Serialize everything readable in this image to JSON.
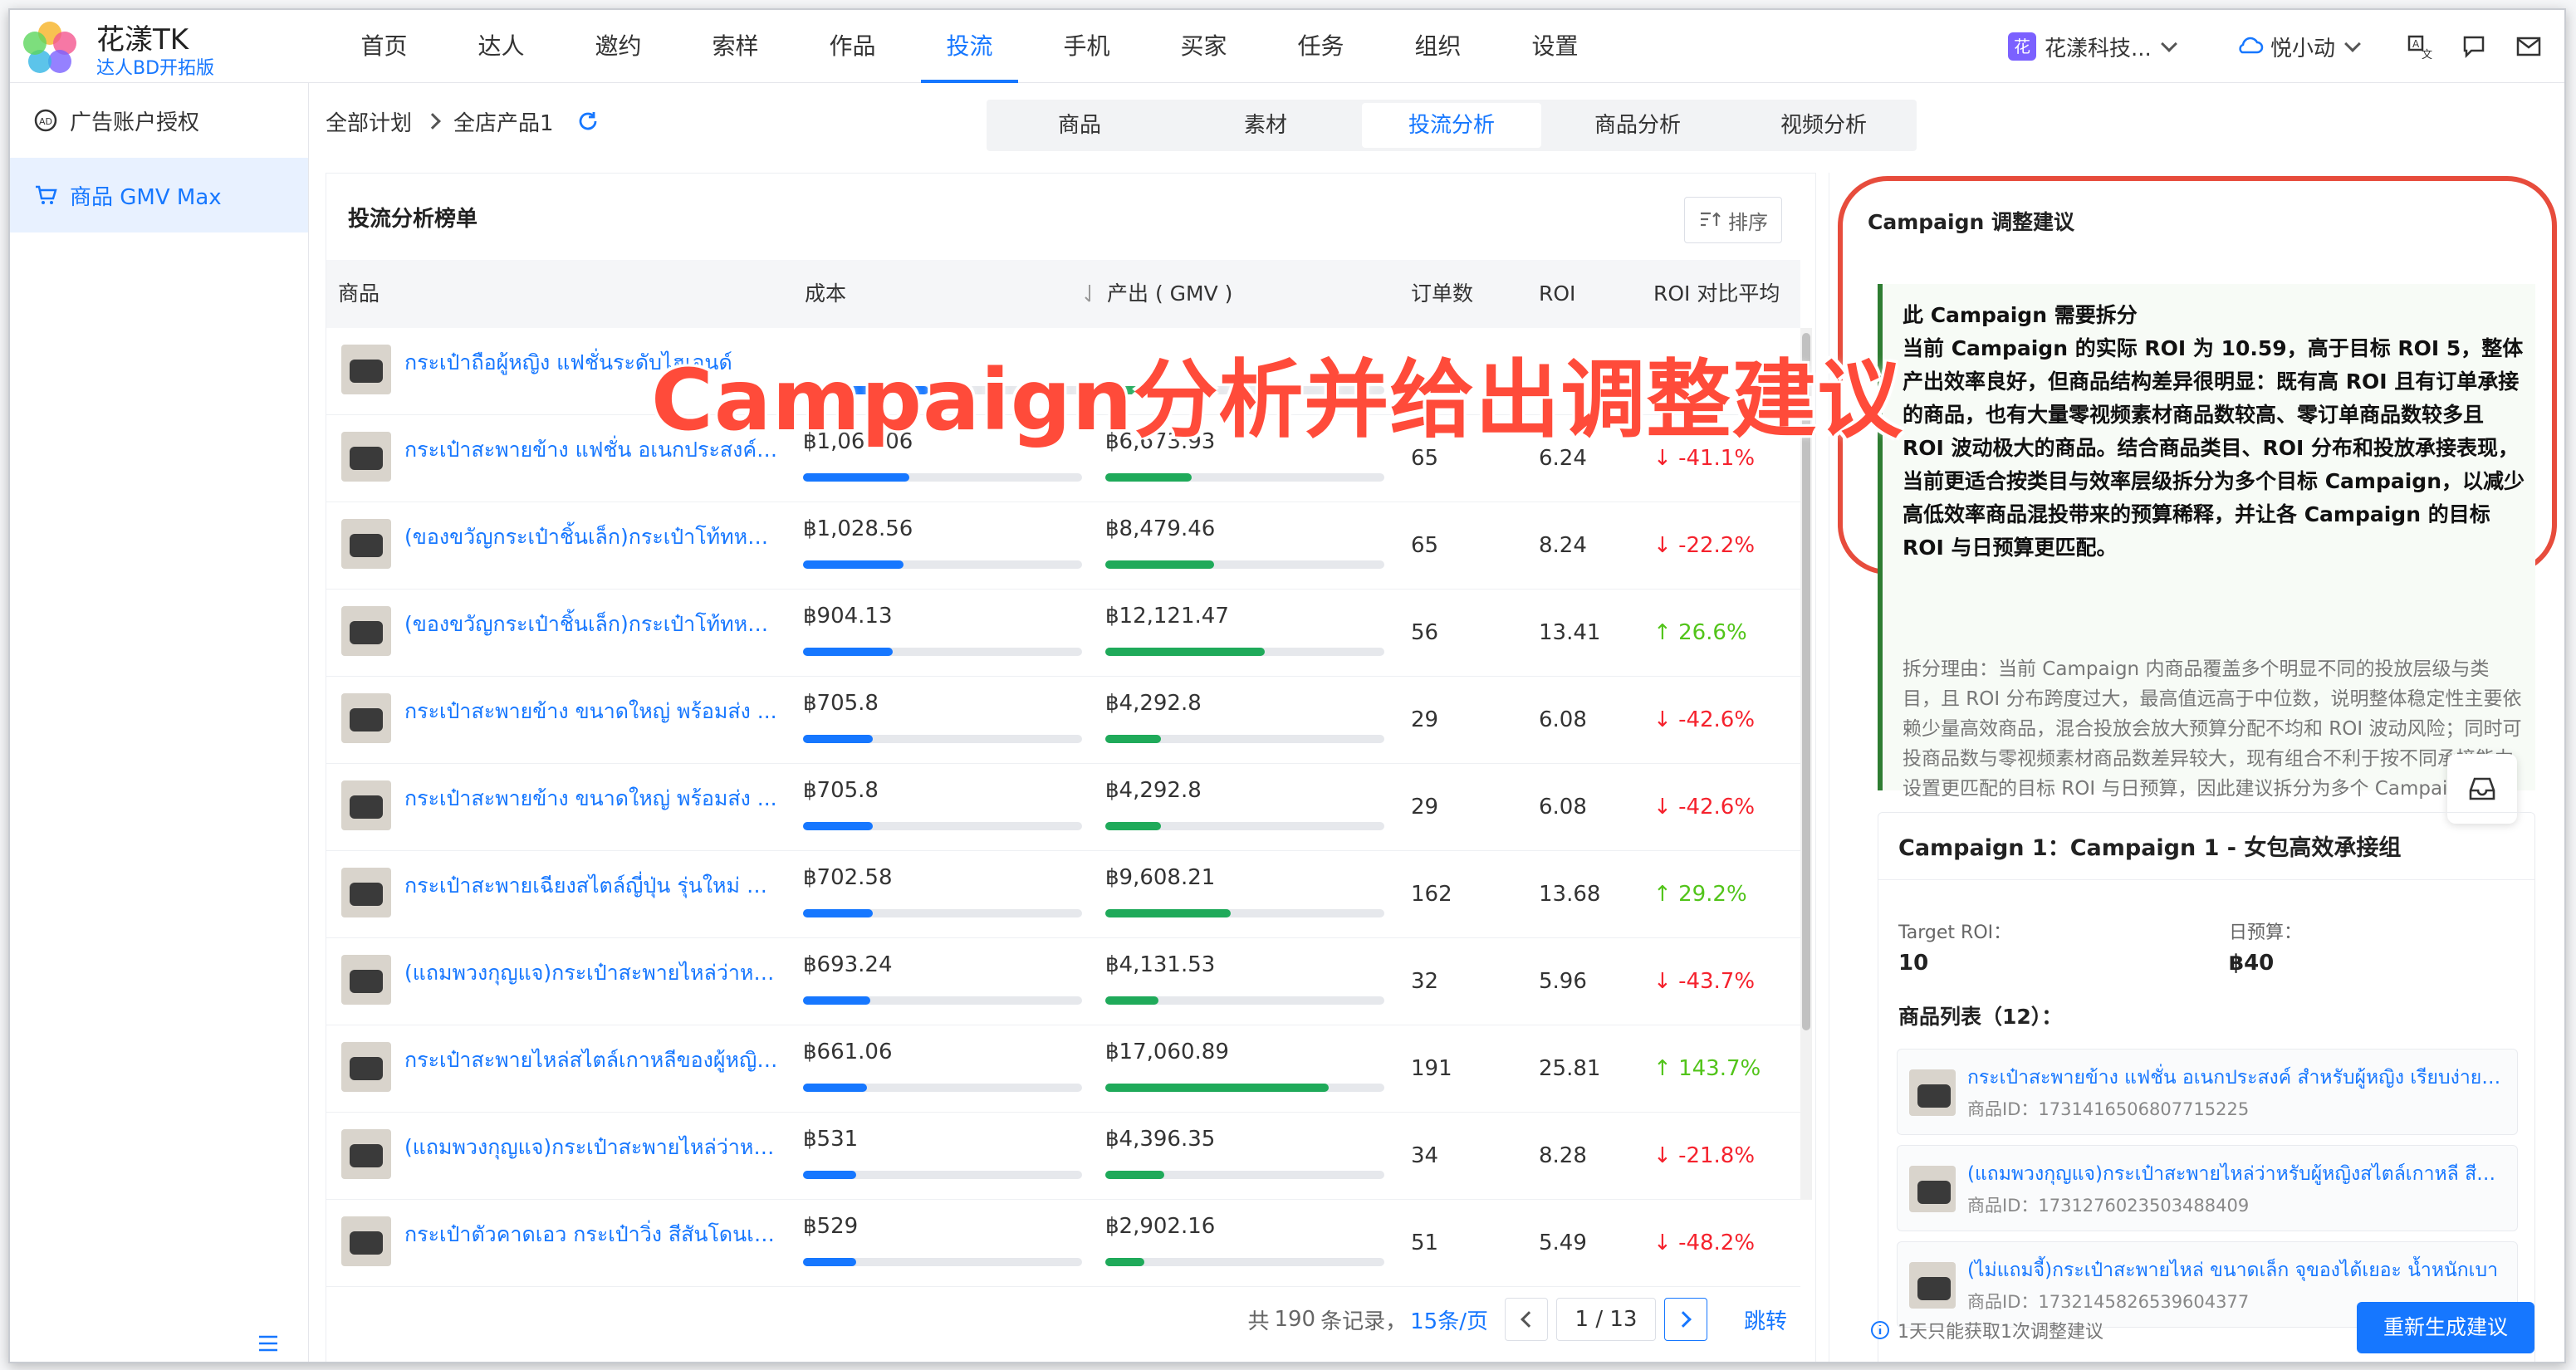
{
  "app": {
    "title": "花漾TK",
    "subtitle": "达人BD开拓版"
  },
  "nav": {
    "items": [
      "首页",
      "达人",
      "邀约",
      "索样",
      "作品",
      "投流",
      "手机",
      "买家",
      "任务",
      "组织",
      "设置"
    ],
    "active": "投流"
  },
  "topright": {
    "org_badge": "花",
    "org_name": "花漾科技...",
    "user_name": "悦小动"
  },
  "sidebar": {
    "items": [
      "广告账户授权",
      "商品 GMV Max"
    ],
    "active": "商品 GMV Max"
  },
  "breadcrumb": {
    "root": "全部计划",
    "current": "全店产品1"
  },
  "tabs": {
    "items": [
      "商品",
      "素材",
      "投流分析",
      "商品分析",
      "视频分析"
    ],
    "active": "投流分析"
  },
  "ranking": {
    "title": "投流分析榜单",
    "sort_label": "排序",
    "headers": {
      "product": "商品",
      "cost": "成本",
      "gmv": "产出 ( GMV )",
      "orders": "订单数",
      "roi": "ROI",
      "roi_vs_avg": "ROI 对比平均"
    },
    "rows": [
      {
        "name": "กระเป๋าถือผู้หญิง แฟชั่นระดับไฮเอนด์",
        "cost": "",
        "cost_pct": 0.45,
        "gmv": "",
        "gmv_pct": 0.3,
        "orders": "",
        "roi": "",
        "cmp": "",
        "dir": ""
      },
      {
        "name": "กระเป๋าสะพายข้าง แฟชั่น อเนกประสงค์ ...",
        "cost": "฿1,069.06",
        "cost_pct": 0.38,
        "gmv": "฿6,673.93",
        "gmv_pct": 0.31,
        "orders": "65",
        "roi": "6.24",
        "cmp": "-41.1%",
        "dir": "down"
      },
      {
        "name": "(ของขวัญกระเป๋าชิ้นเล็ก)กระเป๋าโท้ทหนัง ...",
        "cost": "฿1,028.56",
        "cost_pct": 0.36,
        "gmv": "฿8,479.46",
        "gmv_pct": 0.39,
        "orders": "65",
        "roi": "8.24",
        "cmp": "-22.2%",
        "dir": "down"
      },
      {
        "name": "(ของขวัญกระเป๋าชิ้นเล็ก)กระเป๋าโท้ทหนัง ...",
        "cost": "฿904.13",
        "cost_pct": 0.32,
        "gmv": "฿12,121.47",
        "gmv_pct": 0.57,
        "orders": "56",
        "roi": "13.41",
        "cmp": "26.6%",
        "dir": "up"
      },
      {
        "name": "กระเป๋าสะพายข้าง ขนาดใหญ่ พร้อมส่ง ...",
        "cost": "฿705.8",
        "cost_pct": 0.25,
        "gmv": "฿4,292.8",
        "gmv_pct": 0.2,
        "orders": "29",
        "roi": "6.08",
        "cmp": "-42.6%",
        "dir": "down"
      },
      {
        "name": "กระเป๋าสะพายข้าง ขนาดใหญ่ พร้อมส่ง ...",
        "cost": "฿705.8",
        "cost_pct": 0.25,
        "gmv": "฿4,292.8",
        "gmv_pct": 0.2,
        "orders": "29",
        "roi": "6.08",
        "cmp": "-42.6%",
        "dir": "down"
      },
      {
        "name": "กระเป๋าสะพายเฉียงสไตล์ญี่ปุ่น รุ่นใหม่ ดีไ...",
        "cost": "฿702.58",
        "cost_pct": 0.25,
        "gmv": "฿9,608.21",
        "gmv_pct": 0.45,
        "orders": "162",
        "roi": "13.68",
        "cmp": "29.2%",
        "dir": "up"
      },
      {
        "name": "(แถมพวงกุญแจ)กระเป๋าสะพายไหล่ว่าหรั...",
        "cost": "฿693.24",
        "cost_pct": 0.24,
        "gmv": "฿4,131.53",
        "gmv_pct": 0.19,
        "orders": "32",
        "roi": "5.96",
        "cmp": "-43.7%",
        "dir": "down"
      },
      {
        "name": "กระเป๋าสะพายไหล่สไตล์เกาหลีของผู้หญิง ...",
        "cost": "฿661.06",
        "cost_pct": 0.23,
        "gmv": "฿17,060.89",
        "gmv_pct": 0.8,
        "orders": "191",
        "roi": "25.81",
        "cmp": "143.7%",
        "dir": "up"
      },
      {
        "name": "(แถมพวงกุญแจ)กระเป๋าสะพายไหล่ว่าหรั...",
        "cost": "฿531",
        "cost_pct": 0.19,
        "gmv": "฿4,396.35",
        "gmv_pct": 0.21,
        "orders": "34",
        "roi": "8.28",
        "cmp": "-21.8%",
        "dir": "down"
      },
      {
        "name": "กระเป๋าตัวคาดเอว กระเป๋าวิ่ง สีสันโดนเด่...",
        "cost": "฿529",
        "cost_pct": 0.19,
        "gmv": "฿2,902.16",
        "gmv_pct": 0.14,
        "orders": "51",
        "roi": "5.49",
        "cmp": "-48.2%",
        "dir": "down"
      }
    ]
  },
  "pagination": {
    "total_prefix": "共",
    "total": "190",
    "total_suffix": "条记录，",
    "page_size": "15条/页",
    "page": "1 / 13",
    "jump": "跳转"
  },
  "advice": {
    "title": "Campaign 调整建议",
    "heading": "此 Campaign 需要拆分",
    "body": "当前 Campaign 的实际 ROI 为 10.59，高于目标 ROI 5，整体产出效率良好，但商品结构差异很明显：既有高 ROI 且有订单承接的商品，也有大量零视频素材商品数较高、零订单商品数较多且 ROI 波动极大的商品。结合商品类目、ROI 分布和投放承接表现，当前更适合按类目与效率层级拆分为多个目标 Campaign，以减少高低效率商品混投带来的预算稀释，并让各 Campaign 的目标 ROI 与日预算更匹配。",
    "reason": "拆分理由：当前 Campaign 内商品覆盖多个明显不同的投放层级与类目，且 ROI 分布跨度过大，最高值远高于中位数，说明整体稳定性主要依赖少量高效商品，混合投放会放大预算分配不均和 ROI 波动风险；同时可投商品数与零视频素材商品数差异较大，现有组合不利于按不同承接能力设置更匹配的目标 ROI 与日预算，因此建议拆分为多个 Campaign。"
  },
  "campaign1": {
    "title": "Campaign 1：Campaign 1 - 女包高效承接组",
    "target_roi_label": "Target ROI：",
    "target_roi": "10",
    "budget_label": "日预算：",
    "budget": "฿40",
    "list_label": "商品列表（12）：",
    "products": [
      {
        "name": "กระเป๋าสะพายข้าง แฟชั่น อเนกประสงค์ สำหรับผู้หญิง เรียบง่ายแ...",
        "id": "商品ID：1731416506807715225"
      },
      {
        "name": "(แถมพวงกุญแจ)กระเป๋าสะพายไหล่ว่าหรับผู้หญิงสไตล์เกาหลี สีสัน...",
        "id": "商品ID：1731276023503488409"
      },
      {
        "name": "(ไม่แถมจี้)กระเป๋าสะพายไหล่ ขนาดเล็ก จุของได้เยอะ น้ำหนักเบา",
        "id": "商品ID：1732145826539604377"
      }
    ]
  },
  "footer_note": "1天只能获取1次调整建议",
  "regen_button": "重新生成建议",
  "overlay_text": "Campaign分析并给出调整建议",
  "colors": {
    "accent": "#1677ff",
    "cost_bar": "#1677ff",
    "gmv_bar": "#1faa5a",
    "negative": "#f5222d",
    "positive": "#52c41a",
    "highlight": "#e74c3c"
  }
}
